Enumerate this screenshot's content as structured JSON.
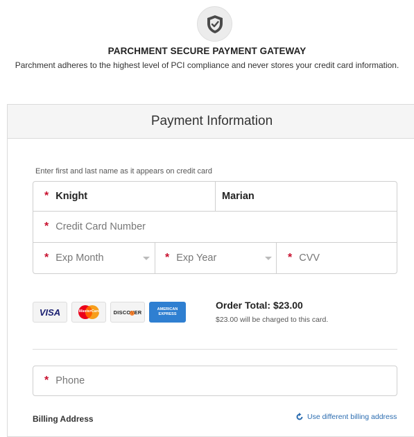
{
  "header": {
    "icon": "shield-check-icon",
    "title": "PARCHMENT SECURE PAYMENT GATEWAY",
    "subtitle": "Parchment adheres to the highest level of PCI compliance and never stores your credit card information."
  },
  "panel": {
    "title": "Payment Information",
    "name_hint": "Enter first and last name as it appears on credit card"
  },
  "form": {
    "last_name": "Knight",
    "first_name": "Marian",
    "card_number_placeholder": "Credit Card Number",
    "exp_month_placeholder": "Exp Month",
    "exp_year_placeholder": "Exp Year",
    "cvv_placeholder": "CVV",
    "phone_placeholder": "Phone",
    "required_marker": "*"
  },
  "cards": {
    "visa": "VISA",
    "mastercard": "MasterCard",
    "discover": "DISCOVER",
    "amex_line1": "AMERICAN",
    "amex_line2": "EXPRESS"
  },
  "order": {
    "total": "Order Total: $23.00",
    "note": "$23.00 will be charged to this card."
  },
  "billing": {
    "label": "Billing Address",
    "link": "Use different billing address"
  },
  "colors": {
    "required": "#c8102e",
    "link": "#2b6cb0",
    "panel_header_bg": "#f5f5f5"
  }
}
